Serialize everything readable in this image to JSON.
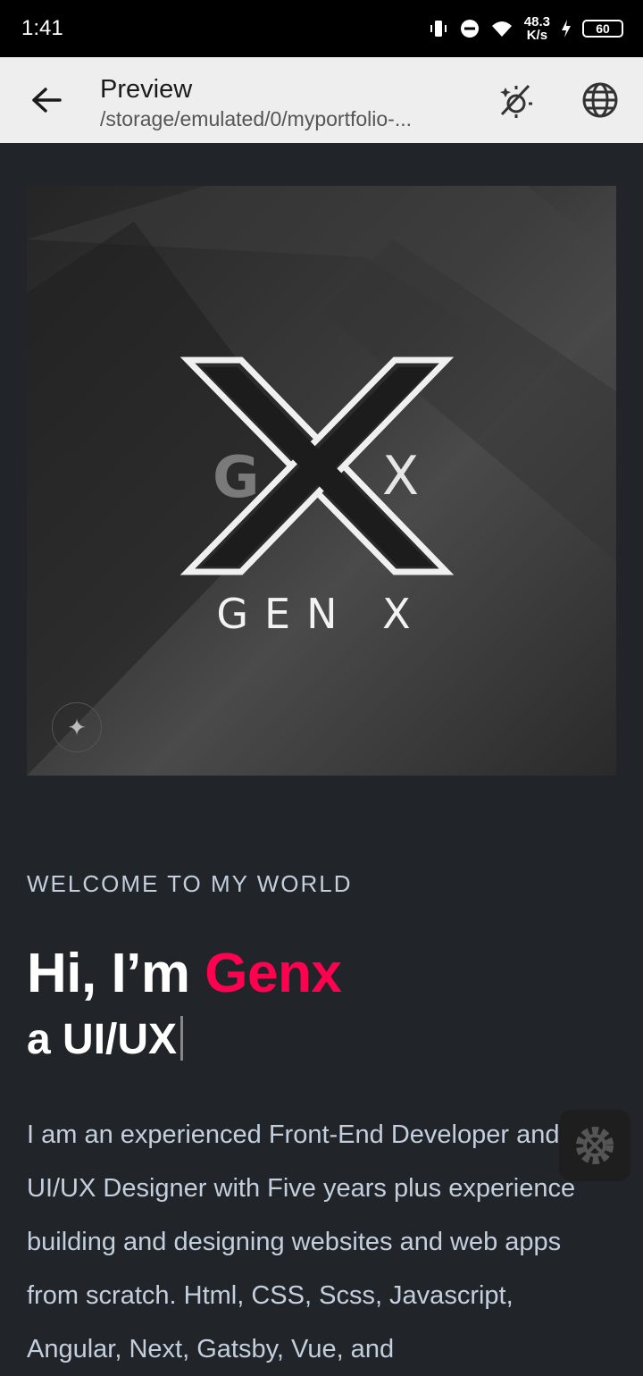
{
  "status_bar": {
    "time": "1:41",
    "speed_value": "48.3",
    "speed_unit": "K/s",
    "battery": "60"
  },
  "toolbar": {
    "title": "Preview",
    "path": "/storage/emulated/0/myportfolio-..."
  },
  "hero": {
    "logo_g": "G",
    "logo_x_small": "X",
    "logo_word": "GEN X"
  },
  "intro": {
    "welcome": "WELCOME TO MY WORLD",
    "greeting": "Hi, I’m ",
    "name": "Genx",
    "subline": "a UI/UX",
    "bio": "I am an experienced Front-End Developer and UI/UX Designer with Five years plus experience building and designing websites and web apps from scratch. Html, CSS, Scss, Javascript, Angular, Next, Gatsby, Vue, and"
  },
  "colors": {
    "accent": "#ff014f",
    "background": "#212428",
    "text": "#c4cfde"
  }
}
